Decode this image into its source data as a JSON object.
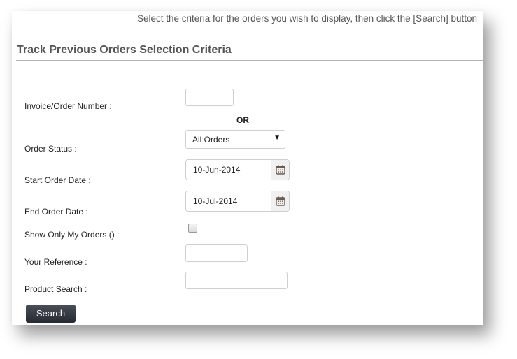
{
  "instructions": "Select the criteria for the orders you wish to display, then click the [Search] button",
  "heading": "Track Previous Orders Selection Criteria",
  "form": {
    "invoice_label": "Invoice/Order Number :",
    "invoice_value": "",
    "or_text": "OR",
    "order_status_label": "Order Status :",
    "order_status_value": "All Orders",
    "start_date_label": "Start Order Date :",
    "start_date_value": "10-Jun-2014",
    "end_date_label": "End Order Date :",
    "end_date_value": "10-Jul-2014",
    "show_only_mine_label": "Show Only My Orders () :",
    "show_only_mine_checked": false,
    "your_reference_label": "Your Reference :",
    "your_reference_value": "",
    "product_search_label": "Product Search :",
    "product_search_value": "",
    "search_button": "Search"
  },
  "icons": {
    "dropdown": "chevron-down-icon",
    "calendar": "calendar-icon"
  }
}
